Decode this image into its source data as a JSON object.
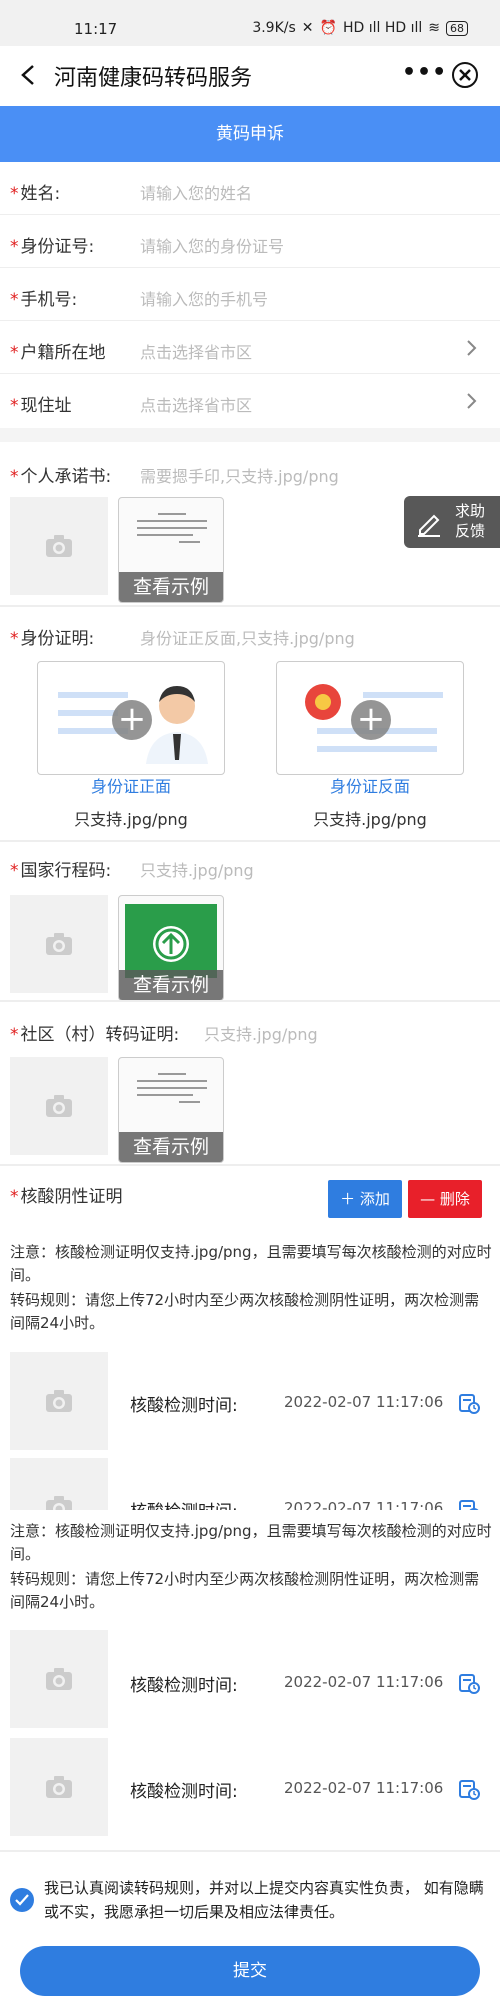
{
  "status_bar": {
    "time": "11:17",
    "net_speed": "3.9K/s",
    "signal": "HD ıll HD ıll",
    "battery": "68"
  },
  "header": {
    "title": "河南健康码转码服务",
    "more": "•••"
  },
  "banner": {
    "title": "黄码申诉"
  },
  "form": {
    "name": {
      "label": "姓名:",
      "placeholder": "请输入您的姓名"
    },
    "id_number": {
      "label": "身份证号:",
      "placeholder": "请输入您的身份证号"
    },
    "phone": {
      "label": "手机号:",
      "placeholder": "请输入您的手机号"
    },
    "household": {
      "label": "户籍所在地",
      "placeholder": "点击选择省市区"
    },
    "residence": {
      "label": "现住址",
      "placeholder": "点击选择省市区"
    }
  },
  "required_mark": "*",
  "uploads": {
    "pledge": {
      "label": "个人承诺书:",
      "hint": "需要摁手印,只支持.jpg/png",
      "sample": "查看示例"
    },
    "id_proof": {
      "label": "身份证明:",
      "hint": "身份证正反面,只支持.jpg/png",
      "front": "身份证正面",
      "back": "身份证反面",
      "format": "只支持.jpg/png"
    },
    "itinerary": {
      "label": "国家行程码:",
      "hint": "只支持.jpg/png",
      "sample": "查看示例"
    },
    "community": {
      "label": "社区（村）转码证明:",
      "hint": "只支持.jpg/png",
      "sample": "查看示例"
    }
  },
  "help_button": {
    "line1": "求助",
    "line2": "反馈"
  },
  "nucleic": {
    "label": "核酸阴性证明",
    "add": "添加",
    "delete": "删除",
    "note": "注意：核酸检测证明仅支持.jpg/png，且需要填写每次核酸检测的对应时间。",
    "rule": "转码规则：请您上传72小时内至少两次核酸检测阴性证明，两次检测需间隔24小时。",
    "time_label": "核酸检测时间:",
    "time_value": "2022-02-07 11:17:06"
  },
  "agreement": "我已认真阅读转码规则，并对以上提交内容真实性负责， 如有隐瞒或不实，我愿承担一切后果及相应法律责任。",
  "submit": "提交",
  "colors": {
    "accent": "#2f7de0",
    "banner": "#4a8ff5",
    "danger": "#e8202a",
    "required": "#e02020"
  }
}
